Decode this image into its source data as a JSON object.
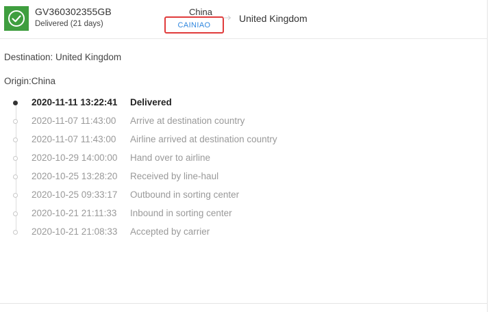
{
  "shipment": {
    "tracking_number": "GV360302355GB",
    "status_summary": "Delivered (21 days)",
    "status_icon": "check-circle-icon",
    "status_color": "#3f9e3f",
    "origin_country": "China",
    "destination_country": "United Kingdom",
    "carrier": "CAINIAO"
  },
  "details": {
    "destination_line": "Destination: United Kingdom",
    "origin_line": "Origin:China"
  },
  "events": [
    {
      "time": "2020-11-11 13:22:41",
      "description": "Delivered",
      "active": true
    },
    {
      "time": "2020-11-07 11:43:00",
      "description": "Arrive at destination country",
      "active": false
    },
    {
      "time": "2020-11-07 11:43:00",
      "description": "Airline arrived at destination country",
      "active": false
    },
    {
      "time": "2020-10-29 14:00:00",
      "description": "Hand over to airline",
      "active": false
    },
    {
      "time": "2020-10-25 13:28:20",
      "description": "Received by line-haul",
      "active": false
    },
    {
      "time": "2020-10-25 09:33:17",
      "description": "Outbound in sorting center",
      "active": false
    },
    {
      "time": "2020-10-21 21:11:33",
      "description": "Inbound in sorting center",
      "active": false
    },
    {
      "time": "2020-10-21 21:08:33",
      "description": "Accepted by carrier",
      "active": false
    }
  ]
}
